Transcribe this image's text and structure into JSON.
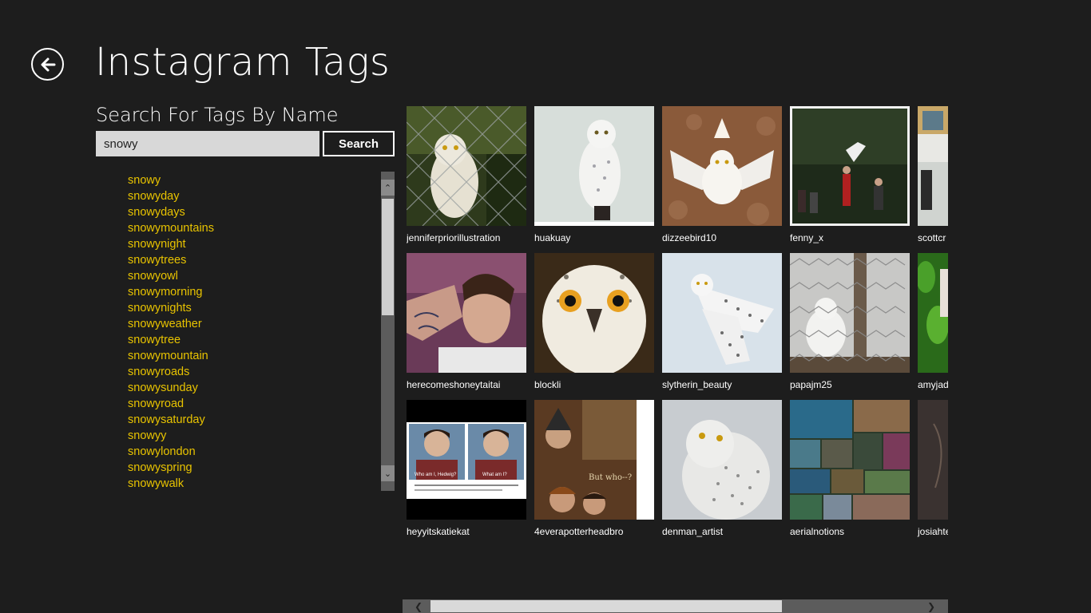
{
  "header": {
    "title": "Instagram Tags",
    "back_icon": "back-arrow-icon"
  },
  "search": {
    "heading": "Search For Tags By Name",
    "value": "snowy",
    "button_label": "Search"
  },
  "tags": [
    "snowy",
    "snowyday",
    "snowydays",
    "snowymountains",
    "snowynight",
    "snowytrees",
    "snowyowl",
    "snowymorning",
    "snowynights",
    "snowyweather",
    "snowytree",
    "snowymountain",
    "snowyroads",
    "snowysunday",
    "snowyroad",
    "snowysaturday",
    "snowyy",
    "snowylondon",
    "snowyspring",
    "snowywalk"
  ],
  "photos": [
    {
      "user": "jenniferpriorillustration"
    },
    {
      "user": "huakuay"
    },
    {
      "user": "dizzeebird10"
    },
    {
      "user": "fenny_x"
    },
    {
      "user": "scottcr"
    },
    {
      "user": "herecomeshoneytaitai"
    },
    {
      "user": "blockli"
    },
    {
      "user": "slytherin_beauty"
    },
    {
      "user": "papajm25"
    },
    {
      "user": "amyjad"
    },
    {
      "user": "heyyitskatiekat"
    },
    {
      "user": "4everapotterheadbro"
    },
    {
      "user": "denman_artist"
    },
    {
      "user": "aerialnotions"
    },
    {
      "user": "josiahte"
    }
  ],
  "photo_texts": {
    "hp_caption_left": "Who am I, Hedwig?",
    "hp_caption_right": "What am I?",
    "hp_poster_text": "But who--?"
  },
  "colors": {
    "background": "#1d1d1d",
    "tag_link": "#e8c300",
    "input_bg": "#d8d8d8"
  }
}
